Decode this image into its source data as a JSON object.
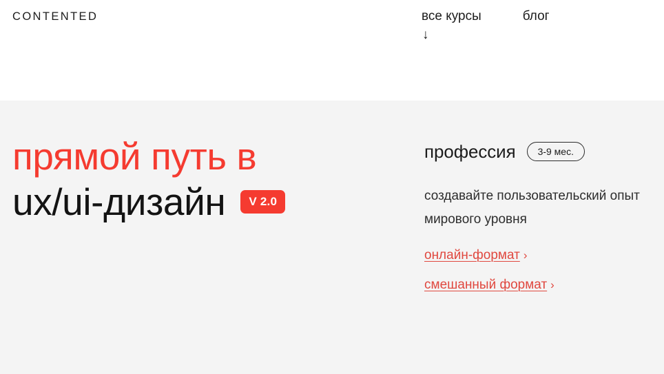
{
  "header": {
    "logo": "CONTENTED",
    "nav": [
      {
        "label": "все курсы",
        "has_arrow": true,
        "arrow_glyph": "↓"
      },
      {
        "label": "блог",
        "has_arrow": false
      }
    ]
  },
  "hero": {
    "headline": {
      "line1": "прямой путь в",
      "line2": "ux/ui-дизайн",
      "version_badge": "V 2.0"
    },
    "subhead": "профессия",
    "duration_badge": "3-9 мес.",
    "description": "создавайте пользовательский опыт мирового уровня",
    "description_lines": [
      "создавайте",
      "пользовательский опыт",
      "мирового уровня"
    ],
    "links": [
      {
        "label": "онлайн-формат",
        "chevron": "›"
      },
      {
        "label": "смешанный формат",
        "chevron": "›"
      }
    ]
  },
  "colors": {
    "accent_red": "#f53b30",
    "link_red": "#e0483f",
    "text_dark": "#1c1c1c",
    "hero_background": "#f4f4f4",
    "header_background": "#ffffff"
  }
}
